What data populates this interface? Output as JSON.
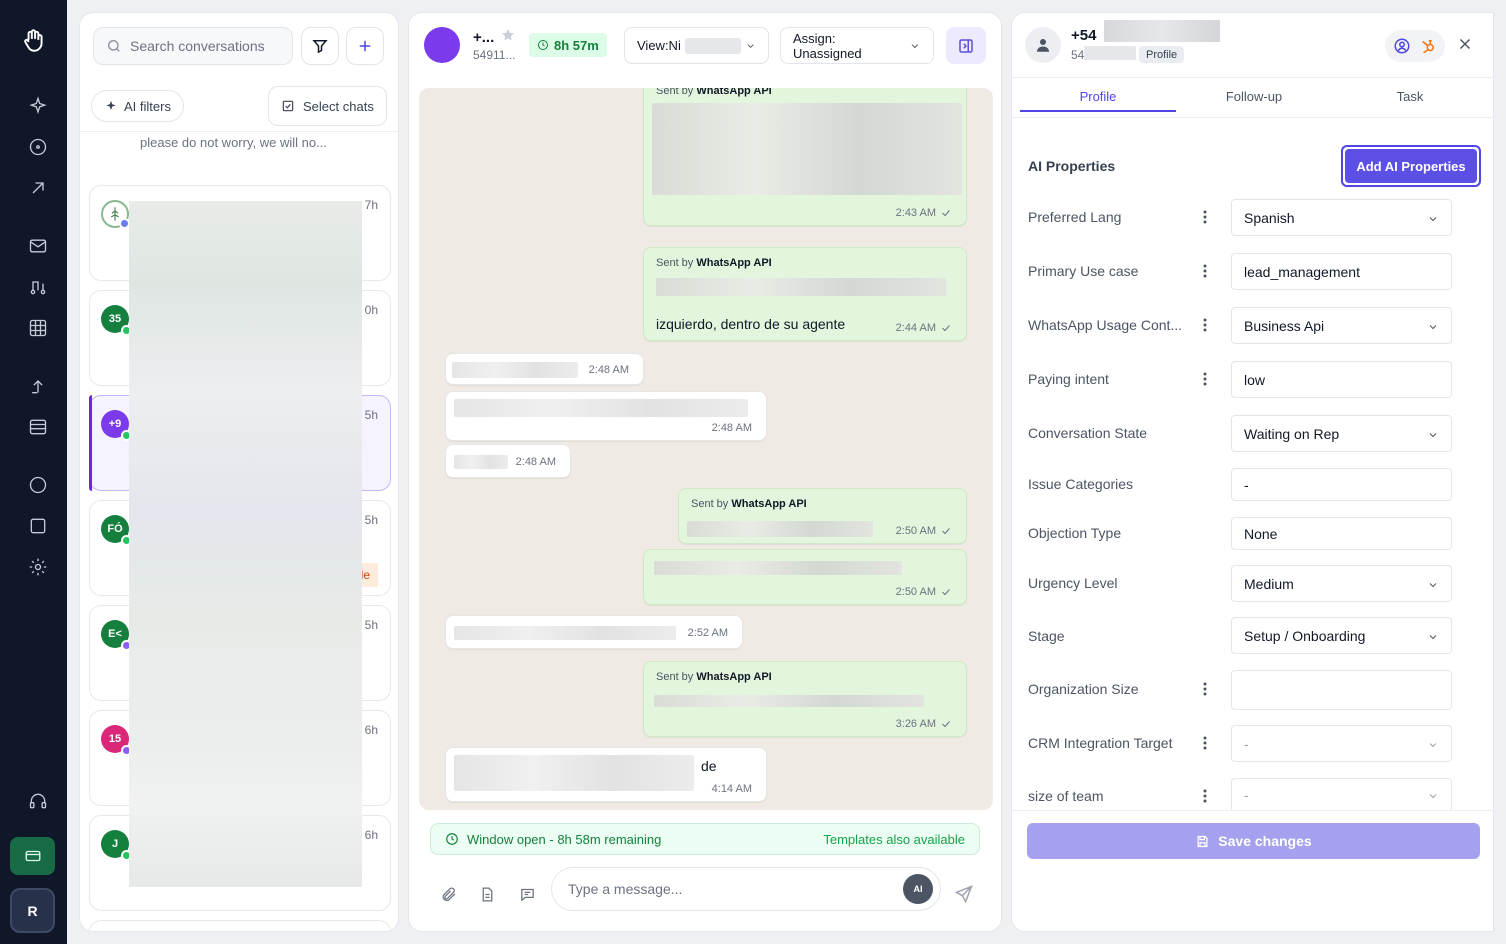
{
  "rail": {
    "icons": [
      "logo-hand-icon",
      "sparkle-icon",
      "compass-icon",
      "arrow-up-right-icon",
      "mail-icon",
      "flow-icon",
      "grid-icon",
      "share-icon",
      "table-icon",
      "circle-icon",
      "square-icon",
      "gear-icon",
      "headset-icon",
      "billing-icon"
    ],
    "user_initial": "R"
  },
  "list": {
    "search_placeholder": "Search conversations",
    "ai_filters_label": "AI filters",
    "select_chats_label": "Select chats",
    "top_preview": "please do not worry, we will no...",
    "partial_tag": "le",
    "conversations": [
      {
        "initials": "",
        "time": "7h",
        "avatar_color": "#ffffff",
        "dot_color": "#6b7cf0"
      },
      {
        "initials": "35",
        "time": "0h",
        "avatar_color": "#15803d",
        "dot_color": "#22c55e"
      },
      {
        "initials": "+9",
        "time": "5h",
        "avatar_color": "#7c3aed",
        "dot_color": "#22c55e"
      },
      {
        "initials": "FÓ",
        "time": "5h",
        "avatar_color": "#15803d",
        "dot_color": "#22c55e"
      },
      {
        "initials": "E<",
        "time": "5h",
        "avatar_color": "#15803d",
        "dot_color": "#8b5cf6"
      },
      {
        "initials": "15",
        "time": "6h",
        "avatar_color": "#db2777",
        "dot_color": "#8b5cf6"
      },
      {
        "initials": "J",
        "time": "6h",
        "avatar_color": "#15803d",
        "dot_color": "#22c55e"
      }
    ]
  },
  "chat": {
    "contact_name": "+...",
    "contact_sub": "54911...",
    "timer": "8h 57m",
    "view_label": "View:Ni",
    "assign_label": "Assign: Unassigned",
    "sent_by_prefix": "Sent by",
    "sent_by_name": "WhatsApp API",
    "messages": [
      {
        "time": "2:43 AM"
      },
      {
        "text": "izquierdo, dentro de su agente",
        "time": "2:44 AM"
      },
      {
        "time": "2:48 AM"
      },
      {
        "time": "2:48 AM"
      },
      {
        "time": "2:48 AM"
      },
      {
        "time": "2:50 AM"
      },
      {
        "time": "2:50 AM"
      },
      {
        "time": "2:52 AM"
      },
      {
        "time": "3:26 AM"
      },
      {
        "text": "de",
        "time": "4:14 AM"
      }
    ],
    "window_status": "Window open - 8h 58m remaining",
    "templates_note": "Templates also available",
    "composer_placeholder": "Type a message...",
    "ai_chip": "AI"
  },
  "profile": {
    "name": "+54",
    "phone": "549",
    "profile_tag": "Profile",
    "tabs": [
      "Profile",
      "Follow-up",
      "Task"
    ],
    "active_tab": "Profile",
    "section_title": "AI Properties",
    "add_button": "Add AI Properties",
    "properties": [
      {
        "label": "Preferred Lang",
        "value": "Spanish",
        "dropdown": true
      },
      {
        "label": "Primary Use case",
        "value": "lead_management",
        "dropdown": false
      },
      {
        "label": "WhatsApp Usage Cont...",
        "value": "Business Api",
        "dropdown": true
      },
      {
        "label": "Paying intent",
        "value": "low",
        "dropdown": false
      },
      {
        "label": "Conversation State",
        "value": "Waiting on Rep",
        "dropdown": true
      },
      {
        "label": "Issue Categories",
        "value": "-",
        "dropdown": false
      },
      {
        "label": "Objection Type",
        "value": "None",
        "dropdown": false
      },
      {
        "label": "Urgency Level",
        "value": "Medium",
        "dropdown": true
      },
      {
        "label": "Stage",
        "value": "Setup / Onboarding",
        "dropdown": true
      },
      {
        "label": "Organization Size",
        "value": "",
        "dropdown": false
      },
      {
        "label": "CRM Integration Target",
        "value": "-",
        "dropdown": true
      },
      {
        "label": "size of team",
        "value": "-",
        "dropdown": true
      }
    ],
    "save_button": "Save changes",
    "colors": {
      "accent": "#4f46e5",
      "save_disabled": "#a5a1ee",
      "whatsapp_green": "#e3f5dc"
    }
  }
}
